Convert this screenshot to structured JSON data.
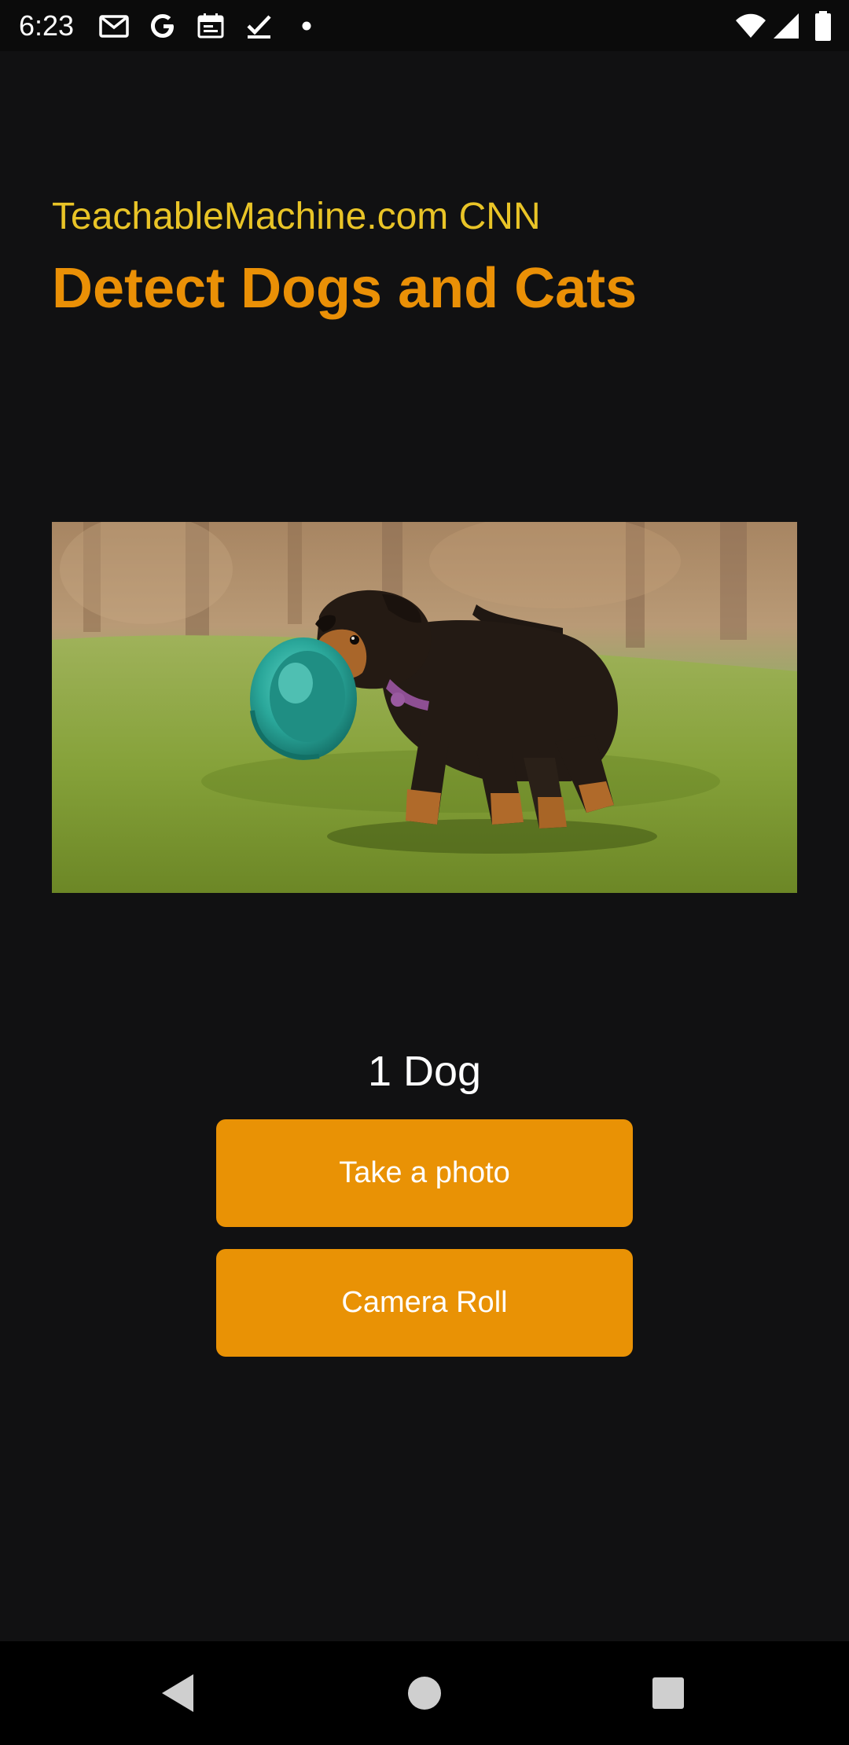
{
  "status_bar": {
    "time": "6:23",
    "left_icons": [
      "gmail-icon",
      "google-icon",
      "calendar-icon",
      "task-check-icon",
      "notification-dot-icon"
    ],
    "right_icons": [
      "wifi-icon",
      "cellular-signal-icon",
      "battery-icon"
    ]
  },
  "header": {
    "subtitle": "TeachableMachine.com CNN",
    "title": "Detect Dogs and Cats"
  },
  "result": {
    "prediction": "1 Dog"
  },
  "buttons": {
    "take_photo": "Take a photo",
    "camera_roll": "Camera Roll"
  },
  "nav": {
    "icons": [
      "back-icon",
      "home-icon",
      "recents-icon"
    ]
  },
  "colors": {
    "background": "#111112",
    "subtitle": "#e9c427",
    "title": "#ea9006",
    "button": "#e99205",
    "button_text": "#ffffff"
  }
}
